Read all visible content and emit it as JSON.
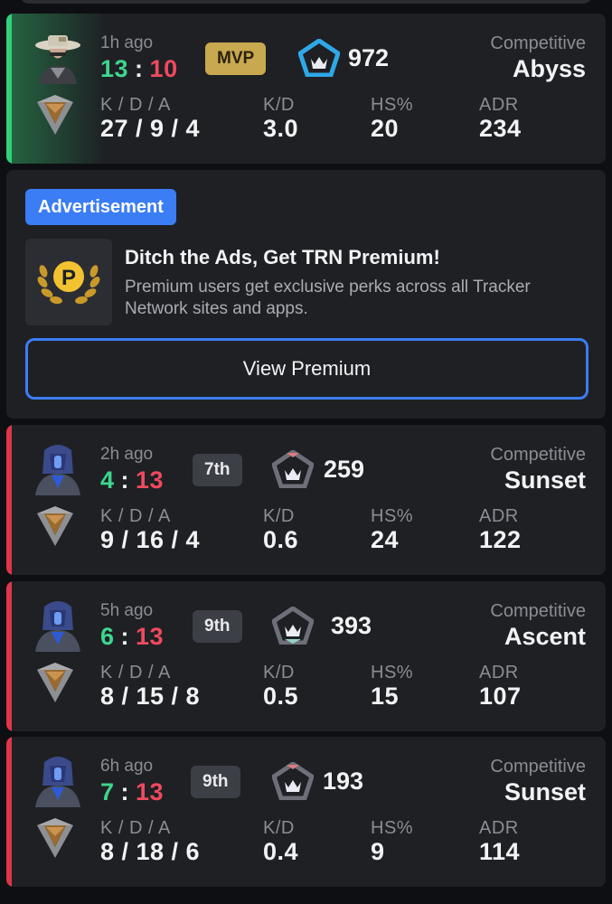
{
  "colors": {
    "win": "#3dd68c",
    "loss": "#ef4a5f",
    "accent_blue": "#3b7df5",
    "mvp_gold": "#c8a94f",
    "card_bg": "#1f2024"
  },
  "matches": [
    {
      "result": "win",
      "agent_icon": "agent-portrait-hat",
      "rank_icon": "bronze-rank-icon",
      "time_ago": "1h ago",
      "score_team": "13",
      "score_sep": ":",
      "score_enemy": "10",
      "badge": "MVP",
      "rr_icon": "rank-rating-icon-blue",
      "rr": "972",
      "mode": "Competitive",
      "map": "Abyss",
      "stats": {
        "kda_label": "K / D / A",
        "kda": "27 / 9 / 4",
        "kd_label": "K/D",
        "kd": "3.0",
        "hs_label": "HS%",
        "hs": "20",
        "adr_label": "ADR",
        "adr": "234"
      }
    },
    {
      "result": "loss",
      "agent_icon": "agent-portrait-helmet",
      "rank_icon": "bronze-rank-icon",
      "time_ago": "2h ago",
      "score_team": "4",
      "score_sep": ":",
      "score_enemy": "13",
      "badge": "7th",
      "rr_icon": "rank-rating-icon-grey",
      "rr": "259",
      "mode": "Competitive",
      "map": "Sunset",
      "stats": {
        "kda_label": "K / D / A",
        "kda": "9 / 16 / 4",
        "kd_label": "K/D",
        "kd": "0.6",
        "hs_label": "HS%",
        "hs": "24",
        "adr_label": "ADR",
        "adr": "122"
      }
    },
    {
      "result": "loss",
      "agent_icon": "agent-portrait-helmet",
      "rank_icon": "bronze-rank-icon",
      "time_ago": "5h ago",
      "score_team": "6",
      "score_sep": ":",
      "score_enemy": "13",
      "badge": "9th",
      "rr_icon": "rank-rating-icon-grey",
      "rr": "393",
      "mode": "Competitive",
      "map": "Ascent",
      "stats": {
        "kda_label": "K / D / A",
        "kda": "8 / 15 / 8",
        "kd_label": "K/D",
        "kd": "0.5",
        "hs_label": "HS%",
        "hs": "15",
        "adr_label": "ADR",
        "adr": "107"
      }
    },
    {
      "result": "loss",
      "agent_icon": "agent-portrait-helmet",
      "rank_icon": "bronze-rank-icon",
      "time_ago": "6h ago",
      "score_team": "7",
      "score_sep": ":",
      "score_enemy": "13",
      "badge": "9th",
      "rr_icon": "rank-rating-icon-grey",
      "rr": "193",
      "mode": "Competitive",
      "map": "Sunset",
      "stats": {
        "kda_label": "K / D / A",
        "kda": "8 / 18 / 6",
        "kd_label": "K/D",
        "kd": "0.4",
        "hs_label": "HS%",
        "hs": "9",
        "adr_label": "ADR",
        "adr": "114"
      }
    }
  ],
  "ad": {
    "tag": "Advertisement",
    "logo_icon": "premium-laurel-icon",
    "title": "Ditch the Ads, Get TRN Premium!",
    "description": "Premium users get exclusive perks across all Tracker Network sites and apps.",
    "button": "View Premium"
  }
}
